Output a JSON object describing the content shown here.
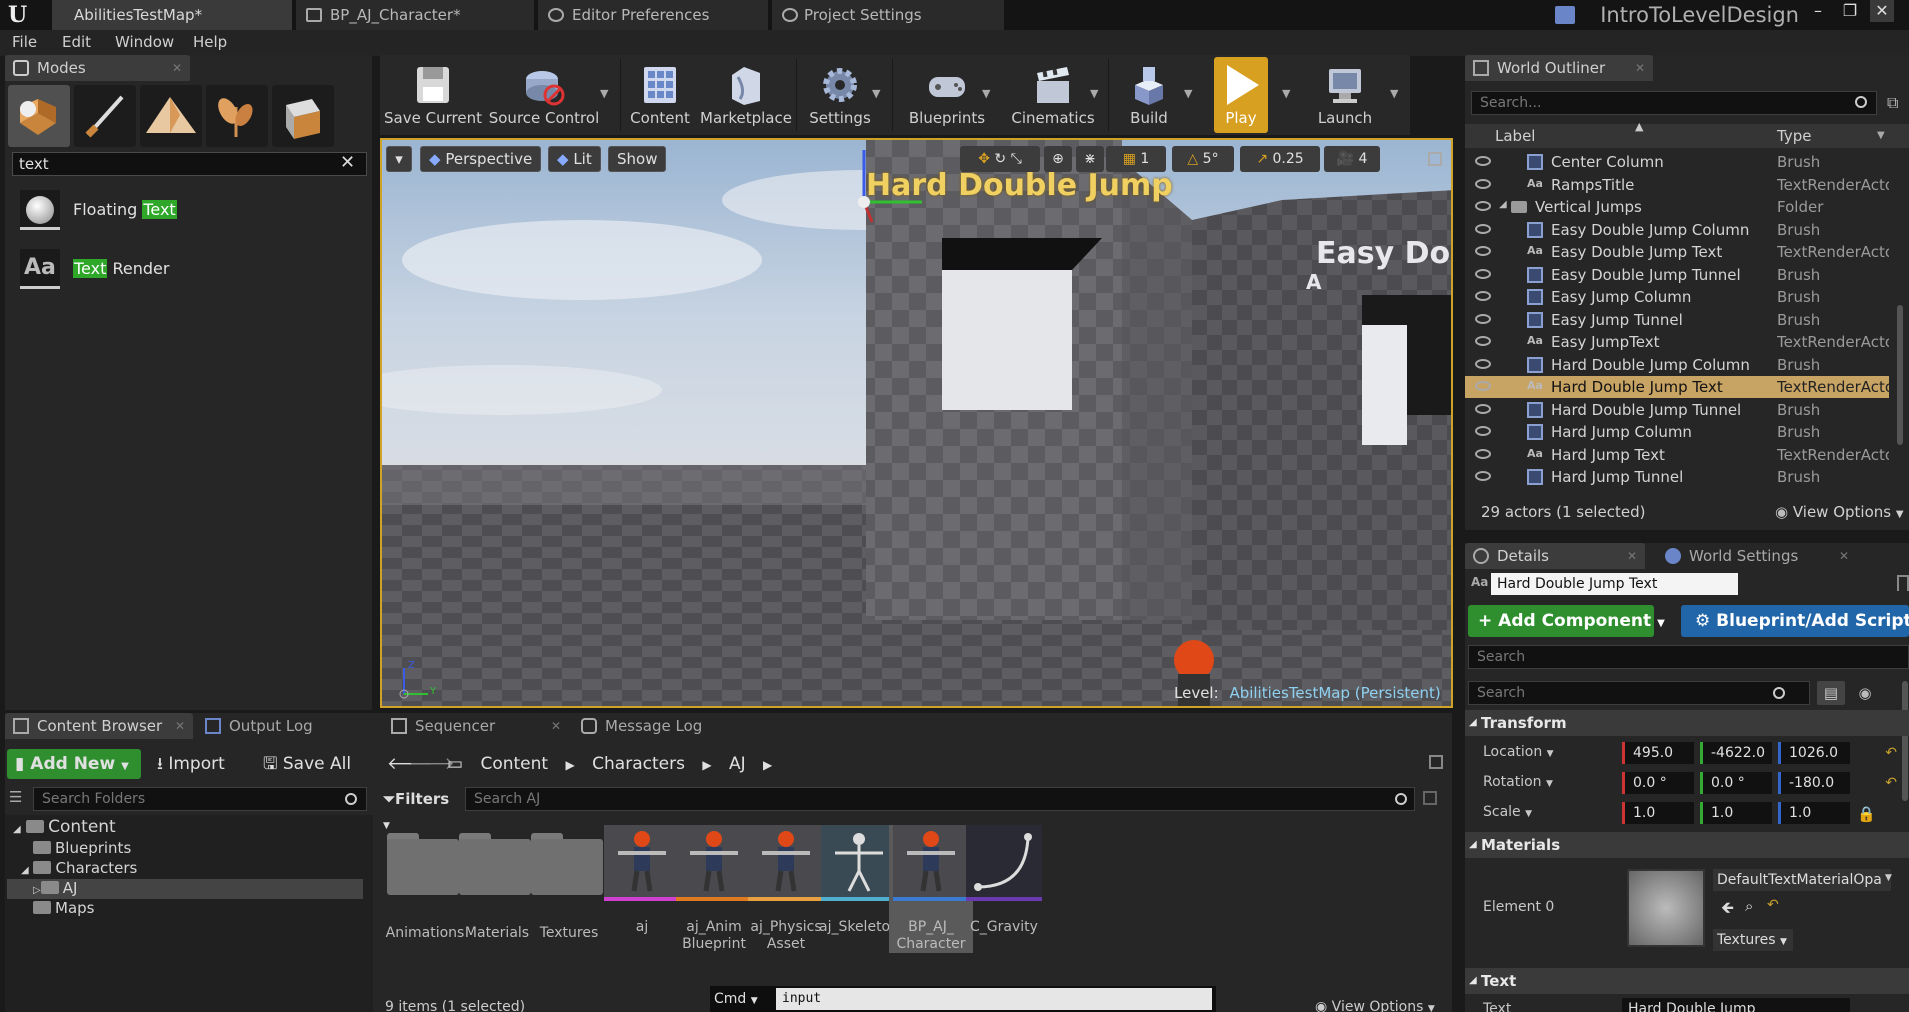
{
  "app": {
    "logo": "U",
    "project_name": "IntroToLevelDesign",
    "doc_tabs": [
      {
        "label": "AbilitiesTestMap*",
        "icon": "map-icon"
      },
      {
        "label": "BP_AJ_Character*",
        "icon": "blueprint-icon"
      },
      {
        "label": "Editor Preferences",
        "icon": "settings-icon"
      },
      {
        "label": "Project Settings",
        "icon": "settings-icon"
      }
    ],
    "window_controls": {
      "minimize": "–",
      "restore": "❐",
      "close": "✕"
    }
  },
  "menu": [
    "File",
    "Edit",
    "Window",
    "Help"
  ],
  "modes": {
    "tab_label": "Modes",
    "search_value": "text",
    "results": [
      {
        "prefix": "Floating ",
        "match": "Text",
        "suffix": "",
        "icon": "sphere-icon"
      },
      {
        "prefix": "",
        "match": "Text",
        "suffix": " Render",
        "icon": "text-render-icon"
      }
    ],
    "mode_icons": [
      "place-mode-icon",
      "paint-mode-icon",
      "landscape-mode-icon",
      "foliage-mode-icon",
      "geometry-mode-icon"
    ]
  },
  "toolbar": [
    {
      "label": "Save Current",
      "icon": "save-icon"
    },
    {
      "label": "Source Control",
      "icon": "source-control-icon"
    },
    {
      "label": "Content",
      "icon": "content-icon"
    },
    {
      "label": "Marketplace",
      "icon": "marketplace-icon"
    },
    {
      "label": "Settings",
      "icon": "gear-icon"
    },
    {
      "label": "Blueprints",
      "icon": "blueprints-icon"
    },
    {
      "label": "Cinematics",
      "icon": "cinematics-icon"
    },
    {
      "label": "Build",
      "icon": "build-icon"
    },
    {
      "label": "Play",
      "icon": "play-icon"
    },
    {
      "label": "Launch",
      "icon": "launch-icon"
    }
  ],
  "viewport": {
    "perspective_label": "Perspective",
    "lit_label": "Lit",
    "show_label": "Show",
    "grid_value": "1",
    "rotation_snap": "5°",
    "scale_snap": "0.25",
    "camera_speed": "4",
    "level_label": "Level:",
    "level_name": "AbilitiesTestMap (Persistent)",
    "scene_text_1": "Hard Double Jump",
    "scene_text_2": "Easy Do",
    "scene_text_3": "A",
    "axis_y": "Y",
    "axis_z": "Z"
  },
  "outliner": {
    "tab_label": "World Outliner",
    "search_placeholder": "Search...",
    "col_label": "Label",
    "col_type": "Type",
    "rows": [
      {
        "label": "Center Column",
        "type": "Brush",
        "indent": 2,
        "kind": "brush"
      },
      {
        "label": "RampsTitle",
        "type": "TextRenderActor",
        "indent": 2,
        "kind": "text"
      },
      {
        "label": "Vertical Jumps",
        "type": "Folder",
        "indent": 1,
        "kind": "folder"
      },
      {
        "label": "Easy Double Jump Column",
        "type": "Brush",
        "indent": 2,
        "kind": "brush"
      },
      {
        "label": "Easy Double Jump Text",
        "type": "TextRenderActor",
        "indent": 2,
        "kind": "text"
      },
      {
        "label": "Easy Double Jump Tunnel",
        "type": "Brush",
        "indent": 2,
        "kind": "brush"
      },
      {
        "label": "Easy Jump Column",
        "type": "Brush",
        "indent": 2,
        "kind": "brush"
      },
      {
        "label": "Easy Jump Tunnel",
        "type": "Brush",
        "indent": 2,
        "kind": "brush"
      },
      {
        "label": "Easy JumpText",
        "type": "TextRenderActor",
        "indent": 2,
        "kind": "text"
      },
      {
        "label": "Hard Double Jump Column",
        "type": "Brush",
        "indent": 2,
        "kind": "brush"
      },
      {
        "label": "Hard Double Jump Text",
        "type": "TextRenderActor",
        "indent": 2,
        "kind": "text",
        "selected": true
      },
      {
        "label": "Hard Double Jump Tunnel",
        "type": "Brush",
        "indent": 2,
        "kind": "brush"
      },
      {
        "label": "Hard Jump Column",
        "type": "Brush",
        "indent": 2,
        "kind": "brush"
      },
      {
        "label": "Hard Jump Text",
        "type": "TextRenderActor",
        "indent": 2,
        "kind": "text"
      },
      {
        "label": "Hard Jump Tunnel",
        "type": "Brush",
        "indent": 2,
        "kind": "brush"
      }
    ],
    "status": "29 actors (1 selected)",
    "view_options": "View Options"
  },
  "details": {
    "tab_label": "Details",
    "world_settings_tab": "World Settings",
    "actor_name": "Hard Double Jump Text",
    "add_component": "+ Add Component",
    "blueprint_script": "Blueprint/Add Script",
    "search_placeholder_1": "Search",
    "search_placeholder_2": "Search",
    "transform_label": "Transform",
    "location_label": "Location",
    "rotation_label": "Rotation",
    "scale_label": "Scale",
    "location": [
      "495.0",
      "-4622.0",
      "1026.0"
    ],
    "rotation": [
      "0.0 °",
      "0.0 °",
      "-180.0"
    ],
    "scale": [
      "1.0",
      "1.0",
      "1.0"
    ],
    "materials_label": "Materials",
    "element_label": "Element 0",
    "material_name": "DefaultTextMaterialOpa",
    "textures_label": "Textures",
    "text_cat_label": "Text",
    "text_prop_label": "Text",
    "text_value": "Hard Double Jump"
  },
  "content_browser": {
    "tab_label": "Content Browser",
    "other_tabs": [
      "Output Log",
      "Sequencer",
      "Message Log"
    ],
    "add_new": "Add New",
    "import": "Import",
    "save_all": "Save All",
    "breadcrumb": [
      "Content",
      "Characters",
      "AJ"
    ],
    "search_folders_placeholder": "Search Folders",
    "filters_label": "Filters",
    "search_assets_placeholder": "Search AJ",
    "tree": [
      {
        "label": "Content",
        "indent": 0,
        "expanded": true
      },
      {
        "label": "Blueprints",
        "indent": 1
      },
      {
        "label": "Characters",
        "indent": 1,
        "expanded": true
      },
      {
        "label": "AJ",
        "indent": 2,
        "selected": true
      },
      {
        "label": "Maps",
        "indent": 1
      }
    ],
    "assets": [
      {
        "label": "Animations",
        "kind": "folder"
      },
      {
        "label": "Materials",
        "kind": "folder"
      },
      {
        "label": "Textures",
        "kind": "folder"
      },
      {
        "label": "aj",
        "kind": "mesh",
        "color": "#d040d0"
      },
      {
        "label": "aj_Anim Blueprint",
        "kind": "animbp",
        "color": "#e07a20"
      },
      {
        "label": "aj_Physics Asset",
        "kind": "physics",
        "color": "#e8a040"
      },
      {
        "label": "aj_Skeleton",
        "kind": "skeleton",
        "color": "#50b0d0"
      },
      {
        "label": "BP_AJ_ Character",
        "kind": "blueprint",
        "color": "#3a7ad0",
        "selected": true
      },
      {
        "label": "C_Gravity",
        "kind": "curve",
        "color": "#6a3ab0"
      }
    ],
    "status": "9 items (1 selected)",
    "view_options": "View Options",
    "cmd_label": "Cmd",
    "cmd_value": "input"
  },
  "colors": {
    "accent": "#d1a228",
    "green_button": "#2f8f2f",
    "blue_button": "#2266aa",
    "selection": "#c8a464"
  }
}
